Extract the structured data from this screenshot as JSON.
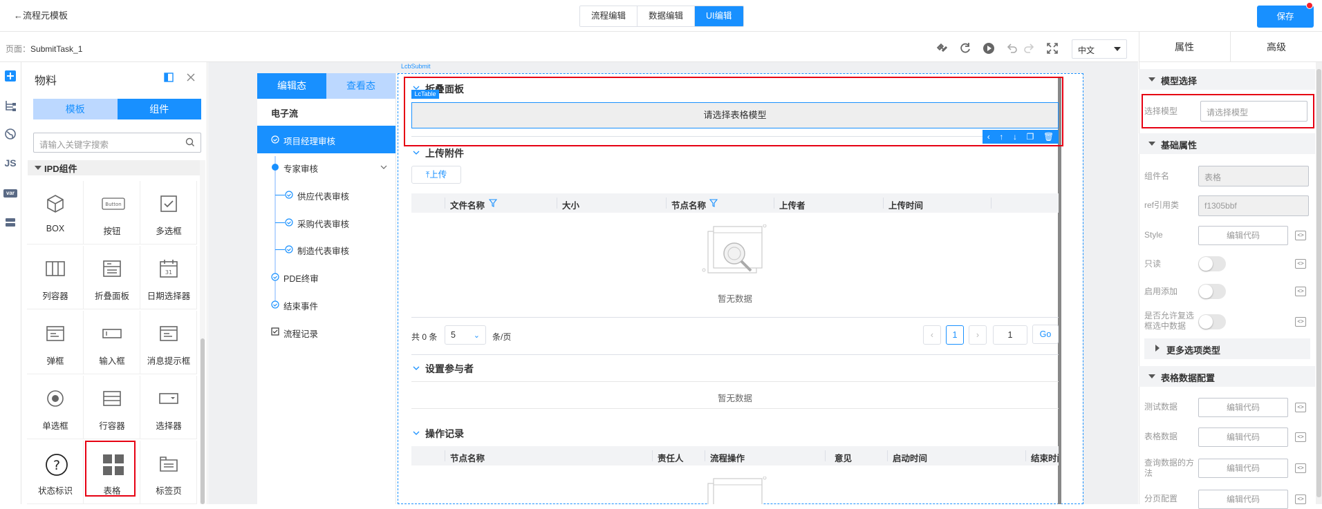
{
  "topbar": {
    "back_label": "←流程元模板",
    "modes": [
      "流程编辑",
      "数据编辑",
      "UI编辑"
    ],
    "active_mode": 2,
    "save_label": "保存"
  },
  "toolbar": {
    "page_prefix": "页面：",
    "page_name": "SubmitTask_1",
    "language": "中文"
  },
  "iconstrip": {
    "js": "JS",
    "var": "var"
  },
  "material": {
    "title": "物料",
    "tabs": [
      "模板",
      "组件"
    ],
    "search_placeholder": "请输入关键字搜索",
    "group": "IPD组件",
    "components": [
      {
        "label": "BOX",
        "icon": "cube-icon"
      },
      {
        "label": "按钮",
        "icon": "button-icon",
        "glyph": "Button"
      },
      {
        "label": "多选框",
        "icon": "checkbox-icon"
      },
      {
        "label": "列容器",
        "icon": "columns-icon"
      },
      {
        "label": "折叠面板",
        "icon": "collapse-icon"
      },
      {
        "label": "日期选择器",
        "icon": "calendar-icon",
        "glyph": "31"
      },
      {
        "label": "弹框",
        "icon": "dialog-icon"
      },
      {
        "label": "输入框",
        "icon": "input-icon"
      },
      {
        "label": "消息提示框",
        "icon": "message-icon"
      },
      {
        "label": "单选框",
        "icon": "radio-icon"
      },
      {
        "label": "行容器",
        "icon": "rows-icon"
      },
      {
        "label": "选择器",
        "icon": "select-icon"
      },
      {
        "label": "状态标识",
        "icon": "status-icon",
        "glyph": "?"
      },
      {
        "label": "表格",
        "icon": "table-icon"
      },
      {
        "label": "标签页",
        "icon": "tabs-icon"
      }
    ]
  },
  "flow": {
    "tabs": [
      "编辑态",
      "查看态"
    ],
    "title": "电子流",
    "nodes": [
      "项目经理审核",
      "专家审核",
      "供应代表审核",
      "采购代表审核",
      "制造代表审核",
      "PDE终审",
      "结束事件"
    ],
    "record": "流程记录"
  },
  "form": {
    "lcb_label": "LcbSubmit",
    "collapse_title": "折叠面板",
    "lctable_tag": "LcTable",
    "table_model_hint": "请选择表格模型",
    "attach_title": "上传附件",
    "upload_label": "上传",
    "attach_columns": [
      "文件名称",
      "大小",
      "节点名称",
      "上传者",
      "上传时间"
    ],
    "empty_text": "暂无数据",
    "pager": {
      "total": "共 0 条",
      "page_size": "5",
      "per_page": "条/页",
      "current": "1",
      "jump": "1",
      "go": "Go"
    },
    "participant_title": "设置参与者",
    "oprecord_title": "操作记录",
    "op_columns": [
      "节点名称",
      "责任人",
      "流程操作",
      "意见",
      "启动时间",
      "结束时间"
    ]
  },
  "props": {
    "tabs": [
      "属性",
      "高级"
    ],
    "model_section": "模型选择",
    "model_label": "选择模型",
    "model_placeholder": "请选择模型",
    "basic_section": "基础属性",
    "comp_name_label": "组件名",
    "comp_name_value": "表格",
    "ref_label": "ref引用类",
    "ref_value": "f1305bbf",
    "style_label": "Style",
    "edit_code": "编辑代码",
    "readonly_label": "只读",
    "enable_add_label": "启用添加",
    "multi_select_label": "是否允许复选框选中数据",
    "more_options": "更多选项类型",
    "table_data_section": "表格数据配置",
    "test_data_label": "测试数据",
    "table_data_label": "表格数据",
    "query_method_label": "查询数据的方法",
    "paging_label": "分页配置"
  }
}
